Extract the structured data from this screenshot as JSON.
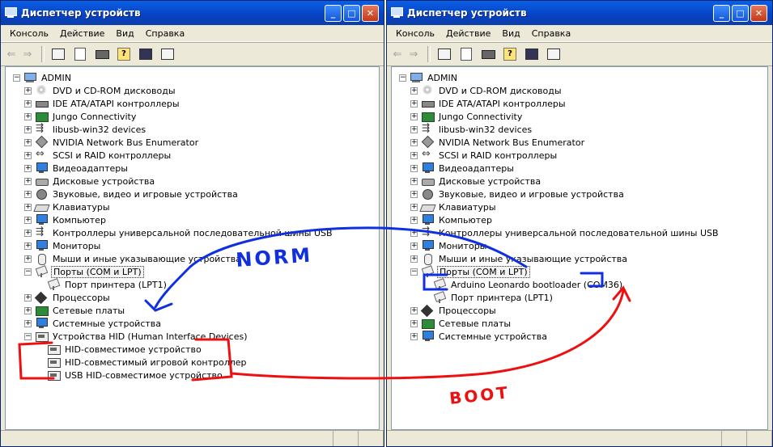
{
  "windows": [
    {
      "title": "Диспетчер устройств",
      "menu": [
        "Консоль",
        "Действие",
        "Вид",
        "Справка"
      ],
      "root": "ADMIN",
      "tree": [
        {
          "label": "DVD и CD-ROM дисководы",
          "icon": "disc-icon",
          "level": 1,
          "exp": "+"
        },
        {
          "label": "IDE ATA/ATAPI контроллеры",
          "icon": "ide-controller-icon",
          "level": 1,
          "exp": "+"
        },
        {
          "label": "Jungo Connectivity",
          "icon": "chip-icon",
          "level": 1,
          "exp": "+"
        },
        {
          "label": "libusb-win32 devices",
          "icon": "usb-icon",
          "level": 1,
          "exp": "+"
        },
        {
          "label": "NVIDIA Network Bus Enumerator",
          "icon": "diamond-icon",
          "level": 1,
          "exp": "+"
        },
        {
          "label": "SCSI и RAID контроллеры",
          "icon": "scsi-icon",
          "level": 1,
          "exp": "+"
        },
        {
          "label": "Видеоадаптеры",
          "icon": "display-icon",
          "level": 1,
          "exp": "+"
        },
        {
          "label": "Дисковые устройства",
          "icon": "hdd-icon",
          "level": 1,
          "exp": "+"
        },
        {
          "label": "Звуковые, видео и игровые устройства",
          "icon": "sound-icon",
          "level": 1,
          "exp": "+"
        },
        {
          "label": "Клавиатуры",
          "icon": "keyboard-icon",
          "level": 1,
          "exp": "+"
        },
        {
          "label": "Компьютер",
          "icon": "display-icon",
          "level": 1,
          "exp": "+"
        },
        {
          "label": "Контроллеры универсальной последовательной шины USB",
          "icon": "usb-icon",
          "level": 1,
          "exp": "+"
        },
        {
          "label": "Мониторы",
          "icon": "display-icon",
          "level": 1,
          "exp": "+"
        },
        {
          "label": "Мыши и иные указывающие устройства",
          "icon": "mouse-icon",
          "level": 1,
          "exp": "+"
        },
        {
          "label": "Порты (COM и LPT)",
          "icon": "port-icon",
          "level": 1,
          "exp": "-",
          "selected": true
        },
        {
          "label": "Порт принтера (LPT1)",
          "icon": "port-icon",
          "level": 2
        },
        {
          "label": "Процессоры",
          "icon": "cpu-icon",
          "level": 1,
          "exp": "+"
        },
        {
          "label": "Сетевые платы",
          "icon": "chip-icon",
          "level": 1,
          "exp": "+"
        },
        {
          "label": "Системные устройства",
          "icon": "display-icon",
          "level": 1,
          "exp": "+"
        },
        {
          "label": "Устройства HID (Human Interface Devices)",
          "icon": "hid-icon",
          "level": 1,
          "exp": "-"
        },
        {
          "label": "HID-совместимое устройство",
          "icon": "hid-icon",
          "level": 2
        },
        {
          "label": "HID-совместимый игровой контроллер",
          "icon": "hid-icon",
          "level": 2
        },
        {
          "label": "USB HID-совместимое устройство",
          "icon": "hid-icon",
          "level": 2
        }
      ]
    },
    {
      "title": "Диспетчер устройств",
      "menu": [
        "Консоль",
        "Действие",
        "Вид",
        "Справка"
      ],
      "root": "ADMIN",
      "tree": [
        {
          "label": "DVD и CD-ROM дисководы",
          "icon": "disc-icon",
          "level": 1,
          "exp": "+"
        },
        {
          "label": "IDE ATA/ATAPI контроллеры",
          "icon": "ide-controller-icon",
          "level": 1,
          "exp": "+"
        },
        {
          "label": "Jungo Connectivity",
          "icon": "chip-icon",
          "level": 1,
          "exp": "+"
        },
        {
          "label": "libusb-win32 devices",
          "icon": "usb-icon",
          "level": 1,
          "exp": "+"
        },
        {
          "label": "NVIDIA Network Bus Enumerator",
          "icon": "diamond-icon",
          "level": 1,
          "exp": "+"
        },
        {
          "label": "SCSI и RAID контроллеры",
          "icon": "scsi-icon",
          "level": 1,
          "exp": "+"
        },
        {
          "label": "Видеоадаптеры",
          "icon": "display-icon",
          "level": 1,
          "exp": "+"
        },
        {
          "label": "Дисковые устройства",
          "icon": "hdd-icon",
          "level": 1,
          "exp": "+"
        },
        {
          "label": "Звуковые, видео и игровые устройства",
          "icon": "sound-icon",
          "level": 1,
          "exp": "+"
        },
        {
          "label": "Клавиатуры",
          "icon": "keyboard-icon",
          "level": 1,
          "exp": "+"
        },
        {
          "label": "Компьютер",
          "icon": "display-icon",
          "level": 1,
          "exp": "+"
        },
        {
          "label": "Контроллеры универсальной последовательной шины USB",
          "icon": "usb-icon",
          "level": 1,
          "exp": "+"
        },
        {
          "label": "Мониторы",
          "icon": "display-icon",
          "level": 1,
          "exp": "+"
        },
        {
          "label": "Мыши и иные указывающие устройства",
          "icon": "mouse-icon",
          "level": 1,
          "exp": "+"
        },
        {
          "label": "Порты (COM и LPT)",
          "icon": "port-icon",
          "level": 1,
          "exp": "-",
          "selected": true
        },
        {
          "label": "Arduino Leonardo bootloader (COM36)",
          "icon": "port-icon",
          "level": 2
        },
        {
          "label": "Порт принтера (LPT1)",
          "icon": "port-icon",
          "level": 2
        },
        {
          "label": "Процессоры",
          "icon": "cpu-icon",
          "level": 1,
          "exp": "+"
        },
        {
          "label": "Сетевые платы",
          "icon": "chip-icon",
          "level": 1,
          "exp": "+"
        },
        {
          "label": "Системные устройства",
          "icon": "display-icon",
          "level": 1,
          "exp": "+"
        }
      ]
    }
  ],
  "annotations": {
    "norm": "NORM",
    "boot": "BOOT",
    "norm_color": "#1030e0",
    "boot_color": "#ee1010"
  },
  "colors": {
    "titlebar": "#0842c3",
    "window_bg": "#ece9d8",
    "selection": "#f4f4f4"
  }
}
